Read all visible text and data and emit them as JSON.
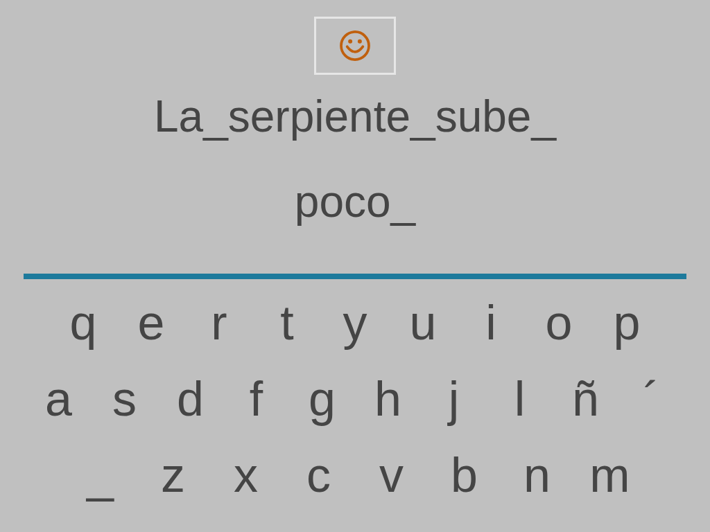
{
  "sentence_lines": [
    "La_serpiente_sube_",
    "poco_"
  ],
  "keyboard_rows": [
    [
      "q",
      "e",
      "r",
      "t",
      "y",
      "u",
      "i",
      "o",
      "p"
    ],
    [
      "a",
      "s",
      "d",
      "f",
      "g",
      "h",
      "j",
      "l",
      "ñ",
      "´"
    ],
    [
      "_",
      "z",
      "x",
      "c",
      "v",
      "b",
      "n",
      "m"
    ]
  ]
}
